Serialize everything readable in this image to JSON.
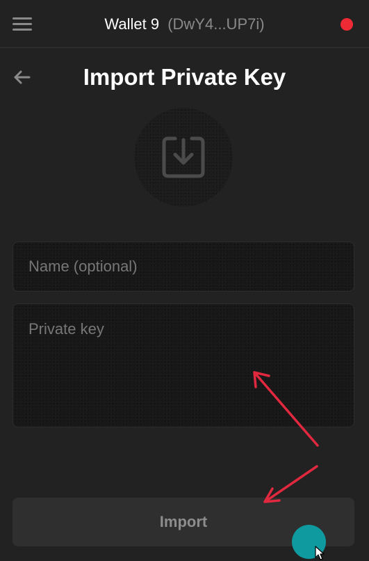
{
  "header": {
    "menu_icon": "hamburger-icon",
    "wallet_name": "Wallet 9",
    "wallet_address": "(DwY4...UP7i)",
    "status_color": "#ee2a35"
  },
  "page": {
    "back_icon": "arrow-left-icon",
    "title": "Import Private Key",
    "badge_icon": "download-box-icon"
  },
  "form": {
    "name_placeholder": "Name (optional)",
    "name_value": "",
    "key_placeholder": "Private key",
    "key_value": "",
    "import_label": "Import"
  },
  "colors": {
    "background": "#222222",
    "field_background": "#181818",
    "button_background": "#2f2f2f",
    "annotation_arrow": "#e0283e",
    "click_marker": "#0f9aa0"
  }
}
